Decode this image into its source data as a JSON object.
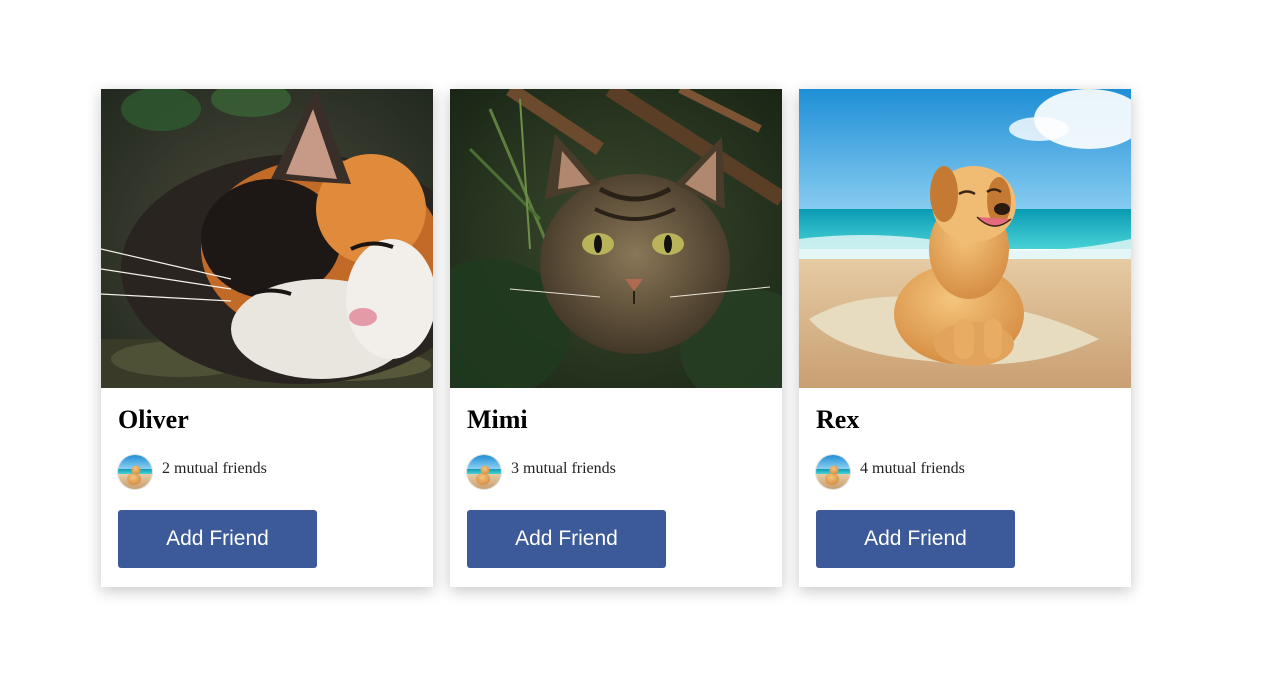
{
  "colors": {
    "button_bg": "#3c5a99",
    "button_text": "#ffffff",
    "card_bg": "#ffffff",
    "page_bg": "#ffffff"
  },
  "cards": [
    {
      "photo_icon": "calico-cat-photo",
      "name": "Oliver",
      "avatar_icon": "dog-on-beach-avatar",
      "mutual_friends": "2 mutual friends",
      "button_label": "Add Friend"
    },
    {
      "photo_icon": "tabby-cat-photo",
      "name": "Mimi",
      "avatar_icon": "dog-on-beach-avatar",
      "mutual_friends": "3 mutual friends",
      "button_label": "Add Friend"
    },
    {
      "photo_icon": "golden-retriever-beach-photo",
      "name": "Rex",
      "avatar_icon": "dog-on-beach-avatar",
      "mutual_friends": "4 mutual friends",
      "button_label": "Add Friend"
    }
  ]
}
